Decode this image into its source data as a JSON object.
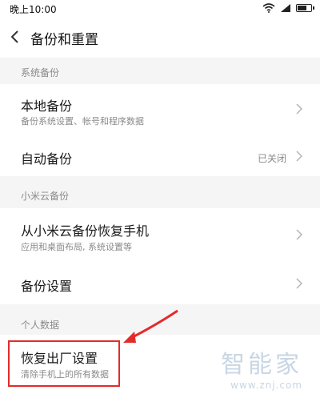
{
  "status_bar": {
    "time": "晚上10:00",
    "icons": [
      "wifi-icon",
      "signal-icon",
      "battery-icon"
    ]
  },
  "header": {
    "back_icon": "chevron-left-icon",
    "title": "备份和重置"
  },
  "sections": [
    {
      "label": "系统备份",
      "items": [
        {
          "title": "本地备份",
          "subtitle": "备份系统设置、帐号和程序数据",
          "value": ""
        },
        {
          "title": "自动备份",
          "subtitle": "",
          "value": "已关闭"
        }
      ]
    },
    {
      "label": "小米云备份",
      "items": [
        {
          "title": "从小米云备份恢复手机",
          "subtitle": "应用和桌面布局, 系统设置等",
          "value": ""
        },
        {
          "title": "备份设置",
          "subtitle": "",
          "value": ""
        }
      ]
    },
    {
      "label": "个人数据",
      "items": [
        {
          "title": "恢复出厂设置",
          "subtitle": "清除手机上的所有数据",
          "value": ""
        }
      ]
    }
  ],
  "annotation": {
    "highlight_color": "#e32b2b"
  },
  "watermark": {
    "logo": "智能家",
    "url": "www.znj.com"
  },
  "colors": {
    "background": "#f5f5f5",
    "card": "#ffffff",
    "secondary_text": "#8a8a8a"
  }
}
